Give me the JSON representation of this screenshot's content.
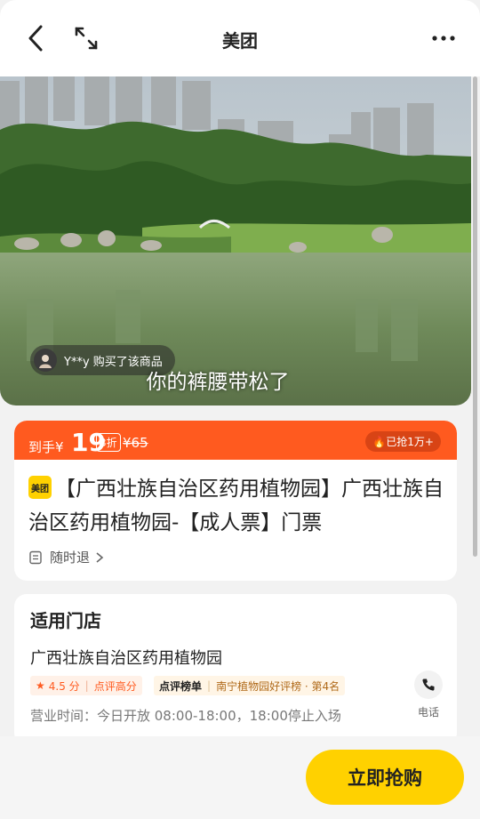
{
  "header": {
    "title": "美团"
  },
  "hero": {
    "buyer_text": "Y**y 购买了该商品",
    "subtitle": "你的裤腰带松了"
  },
  "deal": {
    "price_label": "到手¥",
    "price": "19",
    "discount": "3折",
    "original_price": "¥65",
    "sold": "已抢1万+",
    "logo_text": "美团",
    "name": "【广西壮族自治区药用植物园】广西壮族自治区药用植物园-【成人票】门票",
    "refund": "随时退"
  },
  "store": {
    "section_title": "适用门店",
    "name": "广西壮族自治区药用植物园",
    "rating": "4.5 分",
    "rating_tag": "点评高分",
    "rank_brand": "点评榜单",
    "rank_text": "南宁植物园好评榜 · 第4名",
    "hours": "营业时间：今日开放 08:00-18:00，18:00停止入场",
    "phone_label": "电话"
  },
  "actions": {
    "buy_label": "立即抢购"
  }
}
